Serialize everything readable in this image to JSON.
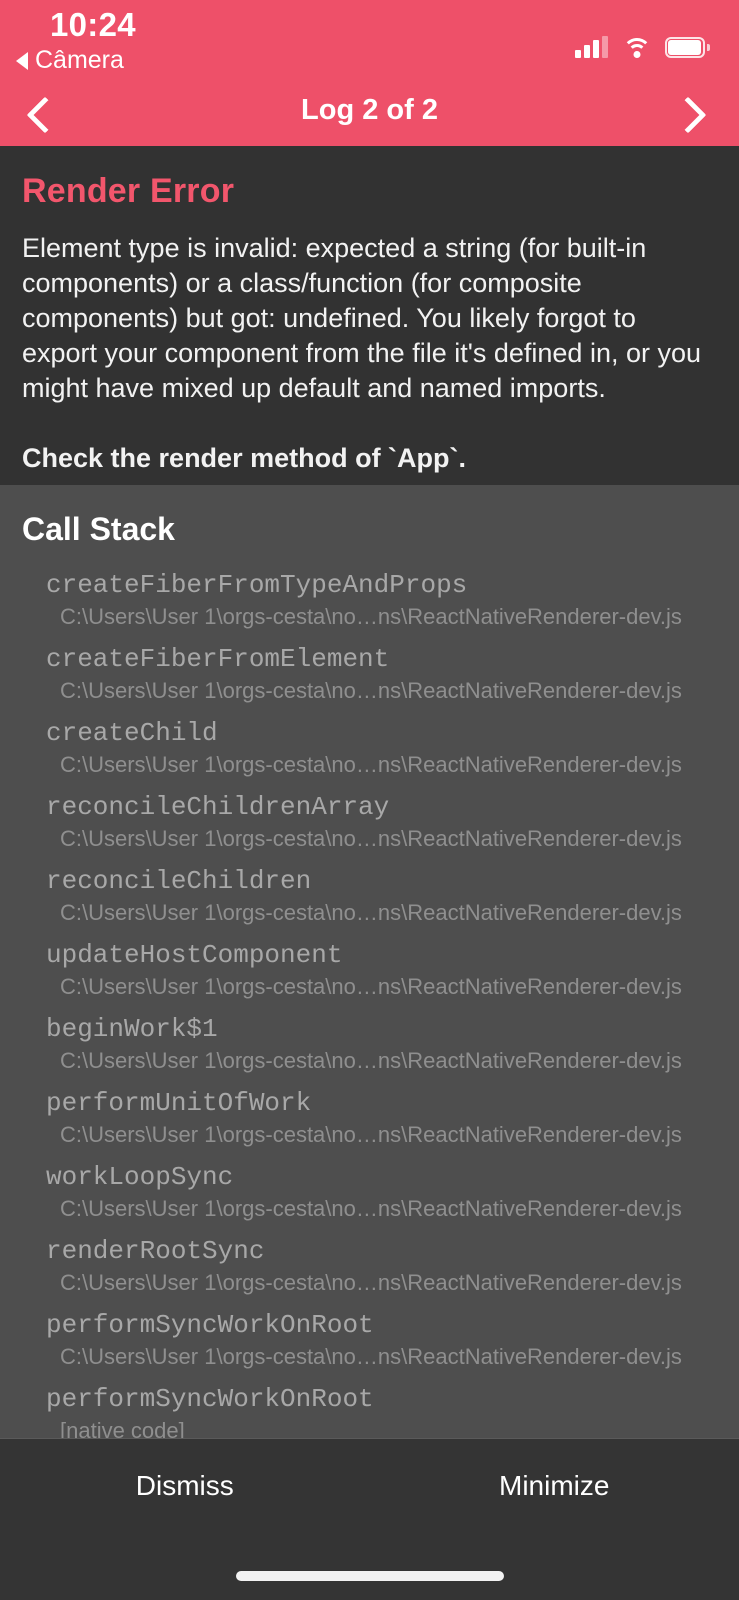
{
  "status_bar": {
    "time": "10:24",
    "back_app_label": "Câmera",
    "back_triangle_icon": "triangle-left-icon",
    "signal_icon": "cellular-signal-icon",
    "wifi_icon": "wifi-icon",
    "battery_icon": "battery-icon"
  },
  "nav": {
    "title": "Log 2 of 2",
    "prev_icon": "chevron-left-icon",
    "next_icon": "chevron-right-icon"
  },
  "error": {
    "title": "Render Error",
    "message": "Element type is invalid: expected a string (for built-in components) or a class/function (for composite components) but got: undefined. You likely forgot to export your component from the file it's defined in, or you might have mixed up default and named imports.",
    "check_line": "Check the render method of `App`."
  },
  "call_stack": {
    "heading": "Call Stack",
    "default_location": "C:\\Users\\User 1\\orgs-cesta\\no…ns\\ReactNativeRenderer-dev.js",
    "frames": [
      {
        "name": "createFiberFromTypeAndProps",
        "location": "C:\\Users\\User 1\\orgs-cesta\\no…ns\\ReactNativeRenderer-dev.js"
      },
      {
        "name": "createFiberFromElement",
        "location": "C:\\Users\\User 1\\orgs-cesta\\no…ns\\ReactNativeRenderer-dev.js"
      },
      {
        "name": "createChild",
        "location": "C:\\Users\\User 1\\orgs-cesta\\no…ns\\ReactNativeRenderer-dev.js"
      },
      {
        "name": "reconcileChildrenArray",
        "location": "C:\\Users\\User 1\\orgs-cesta\\no…ns\\ReactNativeRenderer-dev.js"
      },
      {
        "name": "reconcileChildren",
        "location": "C:\\Users\\User 1\\orgs-cesta\\no…ns\\ReactNativeRenderer-dev.js"
      },
      {
        "name": "updateHostComponent",
        "location": "C:\\Users\\User 1\\orgs-cesta\\no…ns\\ReactNativeRenderer-dev.js"
      },
      {
        "name": "beginWork$1",
        "location": "C:\\Users\\User 1\\orgs-cesta\\no…ns\\ReactNativeRenderer-dev.js"
      },
      {
        "name": "performUnitOfWork",
        "location": "C:\\Users\\User 1\\orgs-cesta\\no…ns\\ReactNativeRenderer-dev.js"
      },
      {
        "name": "workLoopSync",
        "location": "C:\\Users\\User 1\\orgs-cesta\\no…ns\\ReactNativeRenderer-dev.js"
      },
      {
        "name": "renderRootSync",
        "location": "C:\\Users\\User 1\\orgs-cesta\\no…ns\\ReactNativeRenderer-dev.js"
      },
      {
        "name": "performSyncWorkOnRoot",
        "location": "C:\\Users\\User 1\\orgs-cesta\\no…ns\\ReactNativeRenderer-dev.js"
      },
      {
        "name": "performSyncWorkOnRoot",
        "location": "[native code]"
      }
    ]
  },
  "footer": {
    "dismiss_label": "Dismiss",
    "minimize_label": "Minimize"
  },
  "colors": {
    "header_pink": "#ee5069",
    "error_title_red": "#f2566c",
    "error_bg": "#323232",
    "stack_bg": "#4e4e4e",
    "footer_bg": "#343434"
  }
}
